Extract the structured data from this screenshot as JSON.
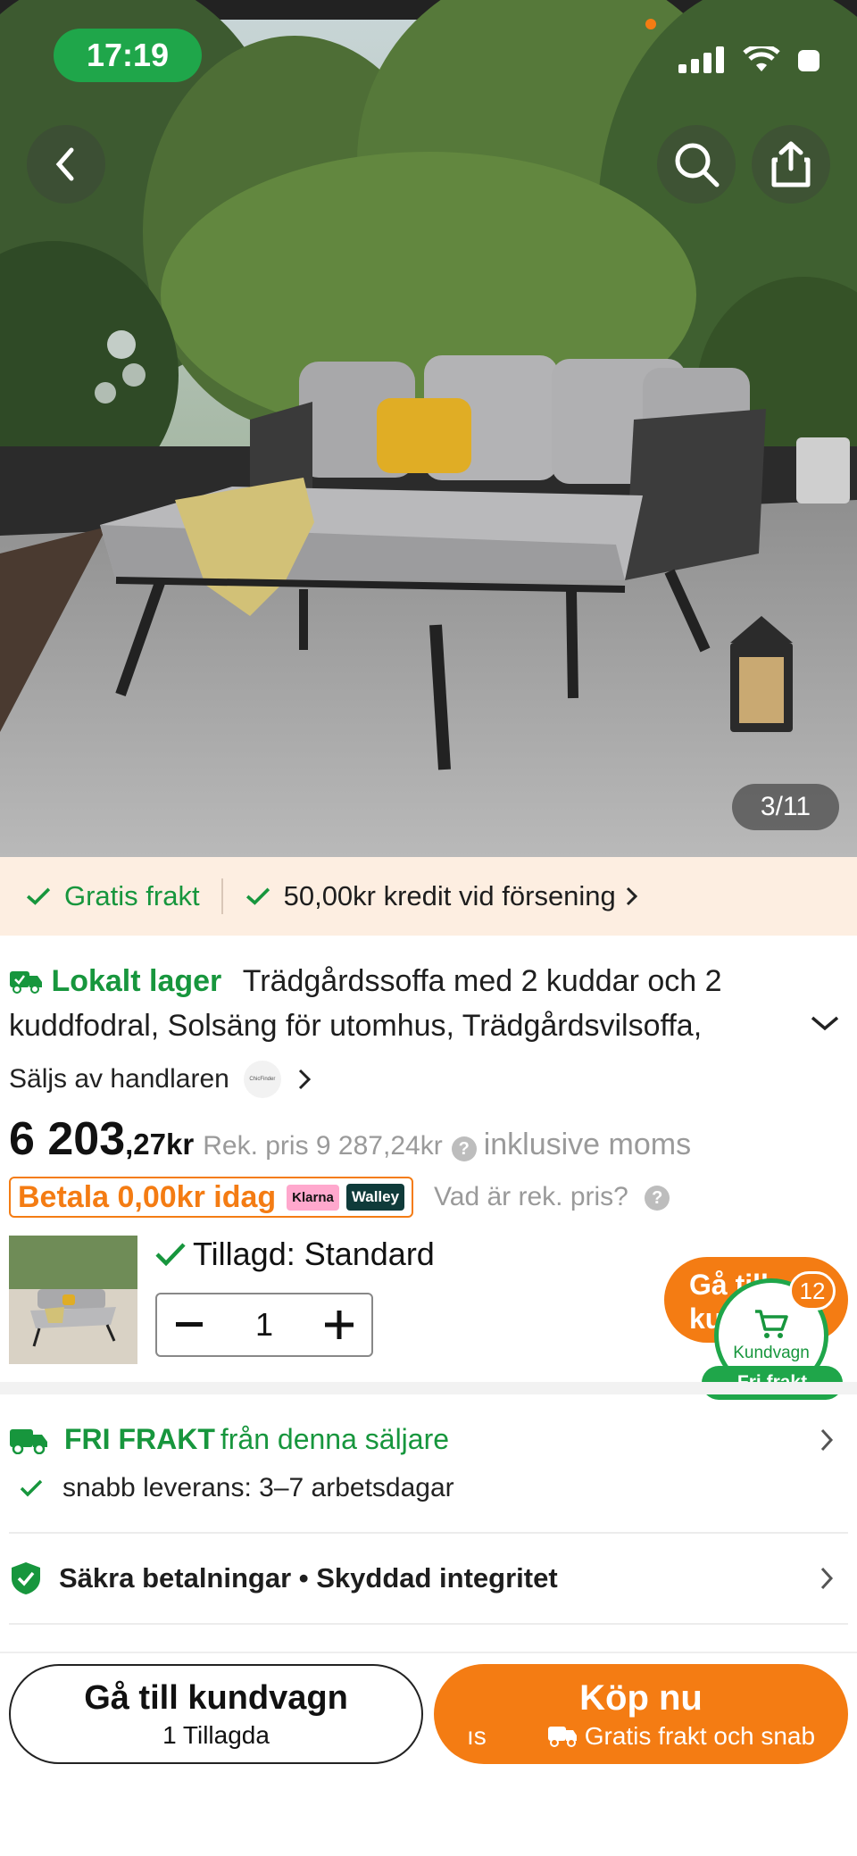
{
  "status_bar": {
    "time": "17:19"
  },
  "gallery": {
    "counter": "3/11"
  },
  "banner": {
    "free_shipping": "Gratis frakt",
    "credit": "50,00kr kredit vid försening"
  },
  "product": {
    "local_stock": "Lokalt lager",
    "title": "Trädgårdssoffa med 2 kuddar och 2 kuddfodral, Solsäng för utomhus, Trädgårdsvilsoffa,",
    "sold_by": "Säljs av handlaren",
    "seller_logo": "ChicFinder",
    "price_main": "6 203",
    "price_decimal": ",27kr",
    "rek_price": "Rek. pris 9 287,24kr",
    "vat_note": "inklusive moms",
    "pay_today": "Betala 0,00kr idag",
    "klarna": "Klarna",
    "walley": "Walley",
    "rek_question": "Vad är rek. pris?",
    "added_label": "Tillagd: Standard",
    "quantity": "1"
  },
  "floating_cart": {
    "goto_label": "Gå till kundvagn",
    "cart_label": "Kundvagn",
    "count": "12",
    "free_pill": "Fri frakt"
  },
  "shipping": {
    "strong": "FRI FRAKT",
    "rest": "från denna säljare",
    "fast": "snabb leverans: 3–7 arbetsdagar"
  },
  "security": {
    "text": "Säkra betalningar • Skyddad integritet"
  },
  "bottom": {
    "cart_button": "Gå till kundvagn",
    "cart_count": "1 Tillagda",
    "buy_button": "Köp nu",
    "buy_sub_prefix": "ıs",
    "buy_sub": "Gratis frakt och snab"
  },
  "colors": {
    "accent": "#f47c13",
    "green": "#17963d",
    "banner_bg": "#fdeee1"
  }
}
